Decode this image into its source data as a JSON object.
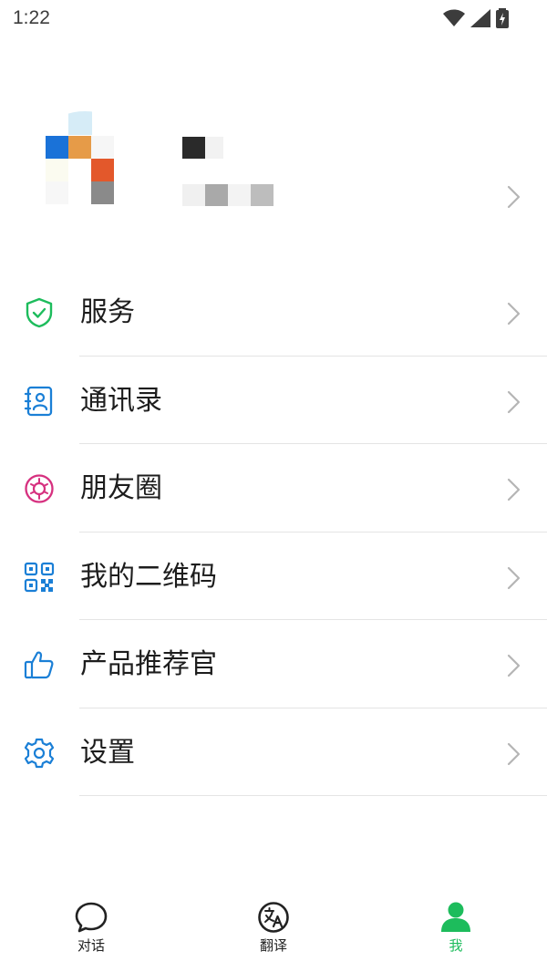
{
  "status_bar": {
    "time": "1:22"
  },
  "menu": {
    "items": [
      {
        "label": "服务",
        "icon": "shield-check-icon",
        "color": "#1dbc5c"
      },
      {
        "label": "通讯录",
        "icon": "contacts-book-icon",
        "color": "#1a7fd6"
      },
      {
        "label": "朋友圈",
        "icon": "moments-aperture-icon",
        "color": "#d6307f"
      },
      {
        "label": "我的二维码",
        "icon": "qr-code-icon",
        "color": "#1a7fd6"
      },
      {
        "label": "产品推荐官",
        "icon": "thumbs-up-icon",
        "color": "#1a7fd6"
      },
      {
        "label": "设置",
        "icon": "gear-icon",
        "color": "#1a7fd6"
      }
    ]
  },
  "tabbar": {
    "tabs": [
      {
        "label": "对话",
        "icon": "chat-bubble-icon",
        "active": false
      },
      {
        "label": "翻译",
        "icon": "translate-icon",
        "active": false
      },
      {
        "label": "我",
        "icon": "person-icon",
        "active": true
      }
    ]
  },
  "colors": {
    "accent_green": "#1dbc5c",
    "icon_blue": "#1a7fd6",
    "icon_pink": "#d6307f",
    "chevron": "#b5b5b5",
    "divider": "#e4e4e4"
  }
}
